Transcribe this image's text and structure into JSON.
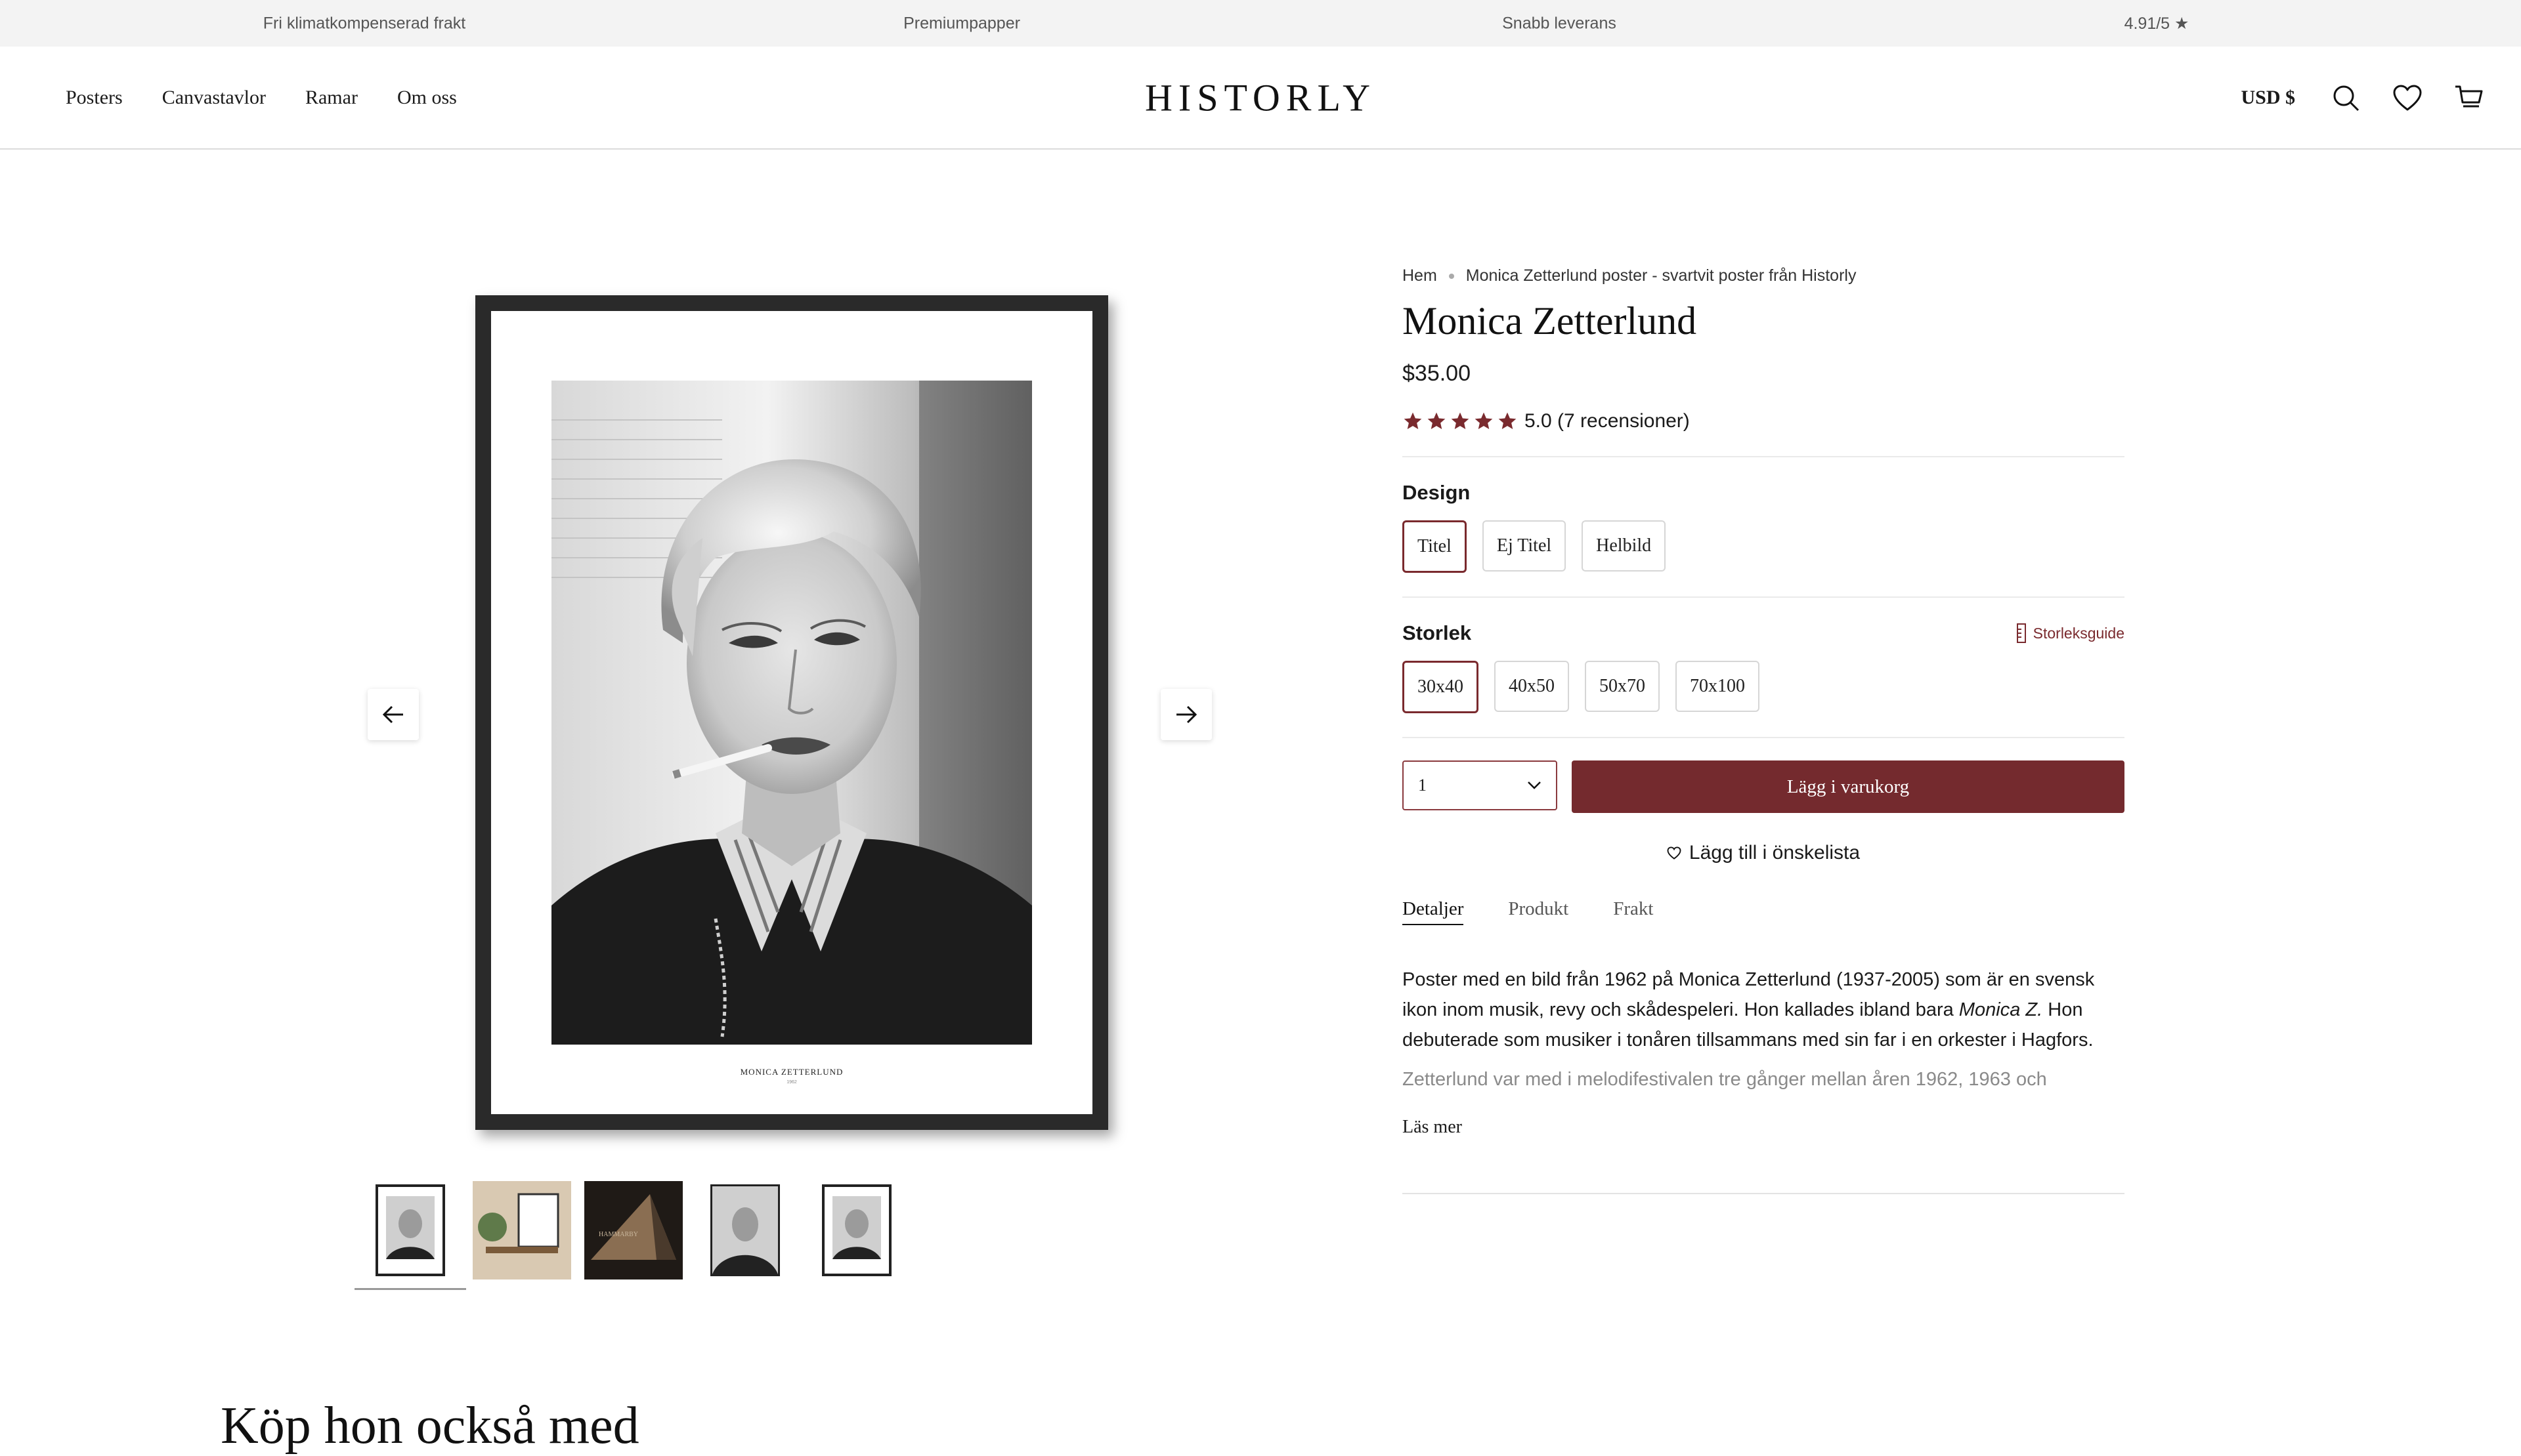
{
  "announcement": [
    "Fri klimatkompenserad frakt",
    "Premiumpapper",
    "Snabb leverans",
    "4.91/5 ★"
  ],
  "header": {
    "nav": [
      "Posters",
      "Canvastavlor",
      "Ramar",
      "Om oss"
    ],
    "logo": "HISTORLY",
    "currency": "USD $",
    "icons": [
      "search-icon",
      "heart-icon",
      "cart-icon"
    ]
  },
  "gallery": {
    "poster_caption": "Monica Zetterlund",
    "poster_year": "1962",
    "thumbnail_count": 5,
    "active_thumbnail": 1
  },
  "breadcrumb": [
    "Hem",
    "Monica Zetterlund poster - svartvit poster från Historly"
  ],
  "product": {
    "title": "Monica Zetterlund",
    "price": "$35.00",
    "rating_value": 5.0,
    "rating_text": "5.0 (7 recensioner)",
    "star_color": "#7a2a2e"
  },
  "design": {
    "label": "Design",
    "options": [
      "Titel",
      "Ej Titel",
      "Helbild"
    ],
    "selected": "Titel"
  },
  "size": {
    "label": "Storlek",
    "guide": "Storleksguide",
    "options": [
      "30x40",
      "40x50",
      "50x70",
      "70x100"
    ],
    "selected": "30x40"
  },
  "cart": {
    "quantity": "1",
    "add_label": "Lägg i varukorg",
    "button_color": "#742a2e",
    "wishlist_label": "Lägg till i önskelista"
  },
  "tabs": [
    "Detaljer",
    "Produkt",
    "Frakt"
  ],
  "description": {
    "part1": "Poster med en bild från 1962 på Monica Zetterlund (1937-2005) som är en svensk ikon inom musik, revy och skådespeleri. Hon kallades ibland bara ",
    "italic": "Monica Z.",
    "part2": " Hon debuterade som musiker i tonåren tillsammans med sin far i en orkester i Hagfors.",
    "fade": "Zetterlund var med i melodifestivalen tre gånger mellan åren 1962, 1963 och",
    "read_more": "Läs mer"
  },
  "section_heading": "Köp hon också med"
}
